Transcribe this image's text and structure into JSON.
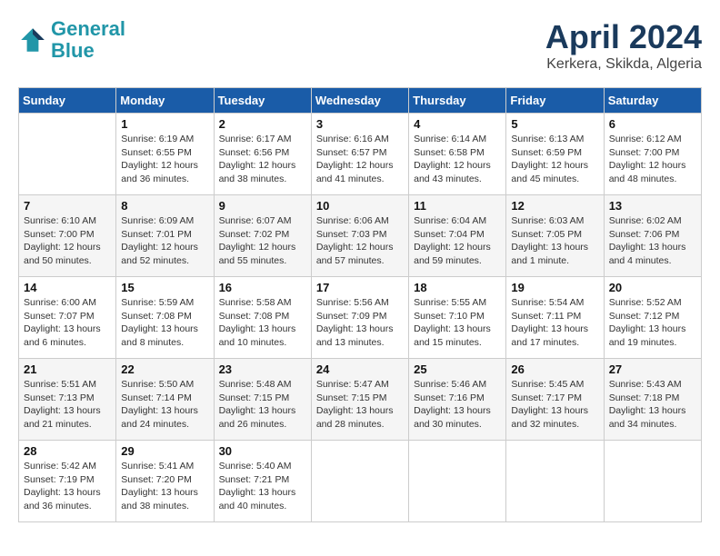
{
  "header": {
    "logo_line1": "General",
    "logo_line2": "Blue",
    "title": "April 2024",
    "subtitle": "Kerkera, Skikda, Algeria"
  },
  "days_of_week": [
    "Sunday",
    "Monday",
    "Tuesday",
    "Wednesday",
    "Thursday",
    "Friday",
    "Saturday"
  ],
  "weeks": [
    [
      {
        "day": "",
        "info": ""
      },
      {
        "day": "1",
        "info": "Sunrise: 6:19 AM\nSunset: 6:55 PM\nDaylight: 12 hours\nand 36 minutes."
      },
      {
        "day": "2",
        "info": "Sunrise: 6:17 AM\nSunset: 6:56 PM\nDaylight: 12 hours\nand 38 minutes."
      },
      {
        "day": "3",
        "info": "Sunrise: 6:16 AM\nSunset: 6:57 PM\nDaylight: 12 hours\nand 41 minutes."
      },
      {
        "day": "4",
        "info": "Sunrise: 6:14 AM\nSunset: 6:58 PM\nDaylight: 12 hours\nand 43 minutes."
      },
      {
        "day": "5",
        "info": "Sunrise: 6:13 AM\nSunset: 6:59 PM\nDaylight: 12 hours\nand 45 minutes."
      },
      {
        "day": "6",
        "info": "Sunrise: 6:12 AM\nSunset: 7:00 PM\nDaylight: 12 hours\nand 48 minutes."
      }
    ],
    [
      {
        "day": "7",
        "info": "Sunrise: 6:10 AM\nSunset: 7:00 PM\nDaylight: 12 hours\nand 50 minutes."
      },
      {
        "day": "8",
        "info": "Sunrise: 6:09 AM\nSunset: 7:01 PM\nDaylight: 12 hours\nand 52 minutes."
      },
      {
        "day": "9",
        "info": "Sunrise: 6:07 AM\nSunset: 7:02 PM\nDaylight: 12 hours\nand 55 minutes."
      },
      {
        "day": "10",
        "info": "Sunrise: 6:06 AM\nSunset: 7:03 PM\nDaylight: 12 hours\nand 57 minutes."
      },
      {
        "day": "11",
        "info": "Sunrise: 6:04 AM\nSunset: 7:04 PM\nDaylight: 12 hours\nand 59 minutes."
      },
      {
        "day": "12",
        "info": "Sunrise: 6:03 AM\nSunset: 7:05 PM\nDaylight: 13 hours\nand 1 minute."
      },
      {
        "day": "13",
        "info": "Sunrise: 6:02 AM\nSunset: 7:06 PM\nDaylight: 13 hours\nand 4 minutes."
      }
    ],
    [
      {
        "day": "14",
        "info": "Sunrise: 6:00 AM\nSunset: 7:07 PM\nDaylight: 13 hours\nand 6 minutes."
      },
      {
        "day": "15",
        "info": "Sunrise: 5:59 AM\nSunset: 7:08 PM\nDaylight: 13 hours\nand 8 minutes."
      },
      {
        "day": "16",
        "info": "Sunrise: 5:58 AM\nSunset: 7:08 PM\nDaylight: 13 hours\nand 10 minutes."
      },
      {
        "day": "17",
        "info": "Sunrise: 5:56 AM\nSunset: 7:09 PM\nDaylight: 13 hours\nand 13 minutes."
      },
      {
        "day": "18",
        "info": "Sunrise: 5:55 AM\nSunset: 7:10 PM\nDaylight: 13 hours\nand 15 minutes."
      },
      {
        "day": "19",
        "info": "Sunrise: 5:54 AM\nSunset: 7:11 PM\nDaylight: 13 hours\nand 17 minutes."
      },
      {
        "day": "20",
        "info": "Sunrise: 5:52 AM\nSunset: 7:12 PM\nDaylight: 13 hours\nand 19 minutes."
      }
    ],
    [
      {
        "day": "21",
        "info": "Sunrise: 5:51 AM\nSunset: 7:13 PM\nDaylight: 13 hours\nand 21 minutes."
      },
      {
        "day": "22",
        "info": "Sunrise: 5:50 AM\nSunset: 7:14 PM\nDaylight: 13 hours\nand 24 minutes."
      },
      {
        "day": "23",
        "info": "Sunrise: 5:48 AM\nSunset: 7:15 PM\nDaylight: 13 hours\nand 26 minutes."
      },
      {
        "day": "24",
        "info": "Sunrise: 5:47 AM\nSunset: 7:15 PM\nDaylight: 13 hours\nand 28 minutes."
      },
      {
        "day": "25",
        "info": "Sunrise: 5:46 AM\nSunset: 7:16 PM\nDaylight: 13 hours\nand 30 minutes."
      },
      {
        "day": "26",
        "info": "Sunrise: 5:45 AM\nSunset: 7:17 PM\nDaylight: 13 hours\nand 32 minutes."
      },
      {
        "day": "27",
        "info": "Sunrise: 5:43 AM\nSunset: 7:18 PM\nDaylight: 13 hours\nand 34 minutes."
      }
    ],
    [
      {
        "day": "28",
        "info": "Sunrise: 5:42 AM\nSunset: 7:19 PM\nDaylight: 13 hours\nand 36 minutes."
      },
      {
        "day": "29",
        "info": "Sunrise: 5:41 AM\nSunset: 7:20 PM\nDaylight: 13 hours\nand 38 minutes."
      },
      {
        "day": "30",
        "info": "Sunrise: 5:40 AM\nSunset: 7:21 PM\nDaylight: 13 hours\nand 40 minutes."
      },
      {
        "day": "",
        "info": ""
      },
      {
        "day": "",
        "info": ""
      },
      {
        "day": "",
        "info": ""
      },
      {
        "day": "",
        "info": ""
      }
    ]
  ]
}
